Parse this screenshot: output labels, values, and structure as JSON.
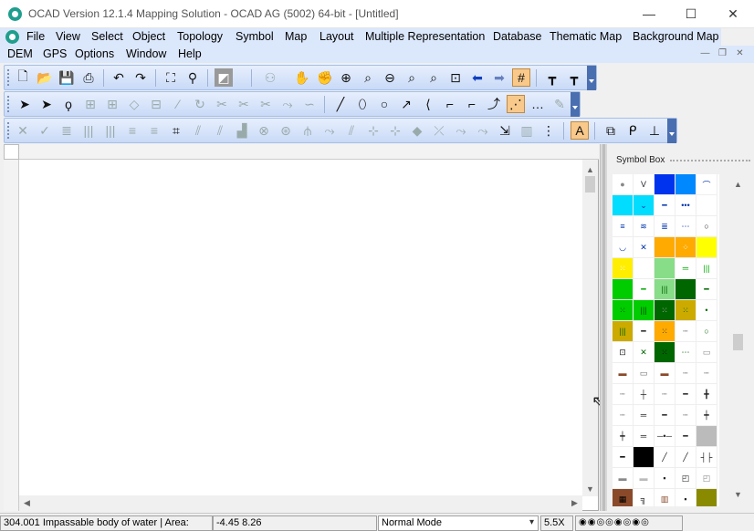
{
  "window": {
    "title": "OCAD Version 12.1.4  Mapping Solution - OCAD AG (5002) 64-bit - [Untitled]",
    "minimize_label": "—",
    "maximize_label": "☐",
    "close_label": "✕"
  },
  "menubar": {
    "row1": [
      "File",
      "View",
      "Select",
      "Object",
      "Topology",
      "Symbol",
      "Map",
      "Layout",
      "Multiple Representation",
      "Database",
      "Thematic Map",
      "Background Map"
    ],
    "row2": [
      "DEM",
      "GPS",
      "Options",
      "Window",
      "Help"
    ]
  },
  "mdi": {
    "min": "—",
    "restore": "❐",
    "close": "✕"
  },
  "toolbar1": [
    "new-icon",
    "open-icon",
    "save-icon",
    "print-icon",
    "undo-icon",
    "redo-icon",
    "fit-icon",
    "preview-icon",
    "hatch-icon",
    "binoculars-icon",
    "pan-icon",
    "grab-icon",
    "zoom-in-icon",
    "zoom-page-icon",
    "zoom-out-icon",
    "zoom-area-icon",
    "zoom-select-icon",
    "zoom-window-icon",
    "back-icon",
    "forward-icon",
    "grid-icon",
    "graphic-icon",
    "cols-icon"
  ],
  "toolbar2": [
    "pointer-icon",
    "edit-object-icon",
    "lasso-icon",
    "node-icon",
    "node2-icon",
    "node3-icon",
    "node4-icon",
    "knife-icon",
    "rotate-icon",
    "scissors-icon",
    "cut-icon",
    "join-icon",
    "extend-icon",
    "line-icon",
    "ellipse-icon",
    "circle-icon",
    "freehand-icon",
    "polygon-icon",
    "step-icon",
    "curve-icon",
    "dot-icon",
    "dots-active-icon",
    "dots-icon",
    "pen-icon"
  ],
  "toolbar3": [
    "delete-icon",
    "check-icon",
    "align-icon",
    "barcode-icon",
    "barcode2-icon",
    "list-icon",
    "crop-icon",
    "fill-icon",
    "flip-icon",
    "rotate2-icon",
    "snap-icon",
    "trace-icon",
    "merge-icon",
    "bend-icon",
    "hatch2-icon",
    "node-move-icon",
    "node-add-icon",
    "node-del-icon",
    "eraser-icon",
    "knife2-icon",
    "extend2-icon",
    "cut2-icon",
    "sort-icon",
    "table-icon",
    "split-icon",
    "text-icon",
    "overlap-icon",
    "connect-icon",
    "perpendicular-icon"
  ],
  "symbox": {
    "title": "Symbol Box",
    "cells": [
      {
        "c": "#ffffff",
        "g": "●",
        "fg": "#888"
      },
      {
        "c": "#ffffff",
        "g": "V",
        "fg": "#223"
      },
      {
        "c": "#0033ee",
        "g": "",
        "fg": "#fff"
      },
      {
        "c": "#0088ff",
        "g": "",
        "fg": "#fff"
      },
      {
        "c": "#ffffff",
        "g": "⌒",
        "fg": "#0033aa"
      },
      {
        "c": "#00ddff",
        "g": "",
        "fg": "#fff"
      },
      {
        "c": "#00ddff",
        "g": "⌄",
        "fg": "#0033aa"
      },
      {
        "c": "#ffffff",
        "g": "━",
        "fg": "#0033aa"
      },
      {
        "c": "#ffffff",
        "g": "•••",
        "fg": "#0033aa"
      },
      {
        "c": "#ffffff",
        "g": "",
        "fg": "#fff"
      },
      {
        "c": "#ffffff",
        "g": "≡",
        "fg": "#0033aa"
      },
      {
        "c": "#ffffff",
        "g": "≋",
        "fg": "#0033aa"
      },
      {
        "c": "#ffffff",
        "g": "≣",
        "fg": "#0033aa"
      },
      {
        "c": "#ffffff",
        "g": "⋯",
        "fg": "#0033aa"
      },
      {
        "c": "#ffffff",
        "g": "○",
        "fg": "#222"
      },
      {
        "c": "#ffffff",
        "g": "◡",
        "fg": "#0033aa"
      },
      {
        "c": "#ffffff",
        "g": "✕",
        "fg": "#0033aa"
      },
      {
        "c": "#ffaa00",
        "g": "",
        "fg": "#fff"
      },
      {
        "c": "#ffaa00",
        "g": "⁘",
        "fg": "#fff"
      },
      {
        "c": "#ffff00",
        "g": "",
        "fg": "#fff"
      },
      {
        "c": "#ffee00",
        "g": "⁙",
        "fg": "#fff"
      },
      {
        "c": "#ffffff",
        "g": "",
        "fg": "#fff"
      },
      {
        "c": "#88dd88",
        "g": "",
        "fg": "#fff"
      },
      {
        "c": "#ffffff",
        "g": "═",
        "fg": "#00aa00"
      },
      {
        "c": "#ffffff",
        "g": "|||",
        "fg": "#00aa00"
      },
      {
        "c": "#00cc00",
        "g": "",
        "fg": "#fff"
      },
      {
        "c": "#ffffff",
        "g": "━",
        "fg": "#00aa00"
      },
      {
        "c": "#88dd88",
        "g": "|||",
        "fg": "#006600"
      },
      {
        "c": "#006600",
        "g": "",
        "fg": "#fff"
      },
      {
        "c": "#ffffff",
        "g": "━",
        "fg": "#006600"
      },
      {
        "c": "#00cc00",
        "g": "⁙",
        "fg": "#004400"
      },
      {
        "c": "#00cc00",
        "g": "|||",
        "fg": "#004400"
      },
      {
        "c": "#006600",
        "g": "⁙",
        "fg": "#aaa"
      },
      {
        "c": "#ccaa00",
        "g": "⁙",
        "fg": "#006600"
      },
      {
        "c": "#ffffff",
        "g": "•",
        "fg": "#006600"
      },
      {
        "c": "#ccaa00",
        "g": "|||",
        "fg": "#006600"
      },
      {
        "c": "#ffffff",
        "g": "━",
        "fg": "#222"
      },
      {
        "c": "#ffaa00",
        "g": "⁙",
        "fg": "#333"
      },
      {
        "c": "#ffffff",
        "g": "┈",
        "fg": "#222"
      },
      {
        "c": "#ffffff",
        "g": "○",
        "fg": "#006600"
      },
      {
        "c": "#ffffff",
        "g": "⊡",
        "fg": "#222"
      },
      {
        "c": "#ffffff",
        "g": "✕",
        "fg": "#006600"
      },
      {
        "c": "#006600",
        "g": "⁙",
        "fg": "#000"
      },
      {
        "c": "#ffffff",
        "g": "⋯",
        "fg": "#006600"
      },
      {
        "c": "#ffffff",
        "g": "▭",
        "fg": "#888"
      },
      {
        "c": "#ffffff",
        "g": "▬",
        "fg": "#8a4a2a"
      },
      {
        "c": "#ffffff",
        "g": "▭",
        "fg": "#666"
      },
      {
        "c": "#ffffff",
        "g": "▬",
        "fg": "#8a4a2a"
      },
      {
        "c": "#ffffff",
        "g": "┈",
        "fg": "#222"
      },
      {
        "c": "#ffffff",
        "g": "┈",
        "fg": "#222"
      },
      {
        "c": "#ffffff",
        "g": "┈",
        "fg": "#222"
      },
      {
        "c": "#ffffff",
        "g": "┼",
        "fg": "#222"
      },
      {
        "c": "#ffffff",
        "g": "┈",
        "fg": "#222"
      },
      {
        "c": "#ffffff",
        "g": "━",
        "fg": "#222"
      },
      {
        "c": "#ffffff",
        "g": "╋",
        "fg": "#222"
      },
      {
        "c": "#ffffff",
        "g": "┈",
        "fg": "#222"
      },
      {
        "c": "#ffffff",
        "g": "═",
        "fg": "#222"
      },
      {
        "c": "#ffffff",
        "g": "━",
        "fg": "#222"
      },
      {
        "c": "#ffffff",
        "g": "┈",
        "fg": "#222"
      },
      {
        "c": "#ffffff",
        "g": "┿",
        "fg": "#222"
      },
      {
        "c": "#ffffff",
        "g": "┿",
        "fg": "#222"
      },
      {
        "c": "#ffffff",
        "g": "═",
        "fg": "#222"
      },
      {
        "c": "#ffffff",
        "g": "─•─",
        "fg": "#222"
      },
      {
        "c": "#ffffff",
        "g": "━",
        "fg": "#222"
      },
      {
        "c": "#bbbbbb",
        "g": "",
        "fg": "#fff"
      },
      {
        "c": "#ffffff",
        "g": "━",
        "fg": "#000"
      },
      {
        "c": "#000000",
        "g": "",
        "fg": "#fff"
      },
      {
        "c": "#ffffff",
        "g": "╱",
        "fg": "#222"
      },
      {
        "c": "#ffffff",
        "g": "╱",
        "fg": "#222"
      },
      {
        "c": "#ffffff",
        "g": "┤├",
        "fg": "#222"
      },
      {
        "c": "#ffffff",
        "g": "▬",
        "fg": "#888"
      },
      {
        "c": "#ffffff",
        "g": "▬",
        "fg": "#bbb"
      },
      {
        "c": "#ffffff",
        "g": "▪",
        "fg": "#222"
      },
      {
        "c": "#ffffff",
        "g": "◰",
        "fg": "#222"
      },
      {
        "c": "#ffffff",
        "g": "◰",
        "fg": "#888"
      },
      {
        "c": "#8a4a2a",
        "g": "▦",
        "fg": "#000"
      },
      {
        "c": "#ffffff",
        "g": "╗",
        "fg": "#222"
      },
      {
        "c": "#ffffff",
        "g": "▥",
        "fg": "#8a4a2a"
      },
      {
        "c": "#ffffff",
        "g": "▪",
        "fg": "#222"
      },
      {
        "c": "#8a8a00",
        "g": "",
        "fg": "#fff"
      },
      {
        "c": "#ffffff",
        "g": "▬",
        "fg": "#222"
      },
      {
        "c": "#bb0000",
        "g": "",
        "fg": "#fff"
      },
      {
        "c": "#ffffff",
        "g": "═",
        "fg": "#222"
      },
      {
        "c": "#ffffff",
        "g": "»»»",
        "fg": "#222"
      },
      {
        "c": "#ffffff",
        "g": "",
        "fg": "#fff"
      }
    ]
  },
  "statusbar": {
    "message": "304.001 Impassable body of water  |  Area:",
    "coords": "-4.45   8.26",
    "mode": "Normal Mode",
    "zoom": "5.5X",
    "views": "◉◉◎◎◉◎◉◎"
  }
}
